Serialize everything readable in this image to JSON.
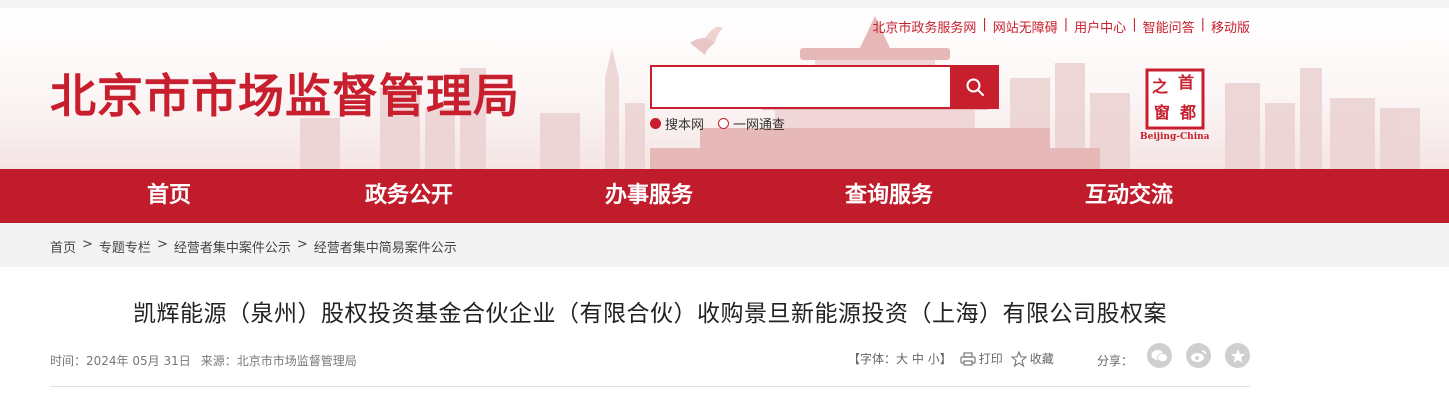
{
  "header": {
    "site_title": "北京市市场监督管理局",
    "top_links": [
      "北京市政务服务网",
      "网站无障碍",
      "用户中心",
      "智能问答",
      "移动版"
    ],
    "search": {
      "placeholder": "",
      "scopes": [
        {
          "label": "搜本网",
          "selected": true
        },
        {
          "label": "一网通查",
          "selected": false
        }
      ]
    },
    "logo": {
      "chars": [
        "之",
        "首",
        "窗",
        "都"
      ],
      "caption": "Beijing-China"
    }
  },
  "nav": {
    "items": [
      "首页",
      "政务公开",
      "办事服务",
      "查询服务",
      "互动交流"
    ]
  },
  "breadcrumb": {
    "items": [
      "首页",
      "专题专栏",
      "经营者集中案件公示",
      "经营者集中简易案件公示"
    ],
    "separator": ">"
  },
  "article": {
    "title": "凯辉能源（泉州）股权投资基金合伙企业（有限合伙）收购景旦新能源投资（上海）有限公司股权案",
    "meta": {
      "time_label": "时间：",
      "time_value": "2024年 05月 31日",
      "source_label": "来源：",
      "source_value": "北京市市场监督管理局"
    },
    "tools": {
      "font_label": "【字体：",
      "font_large": "大",
      "font_medium": "中",
      "font_small": "小",
      "font_close": "】",
      "print": "打印",
      "favorite": "收藏"
    },
    "share_label": "分享："
  },
  "colors": {
    "brand_red": "#c01c2c",
    "title_red": "#c71f2d",
    "breadcrumb_bg": "#f3f3f3"
  }
}
